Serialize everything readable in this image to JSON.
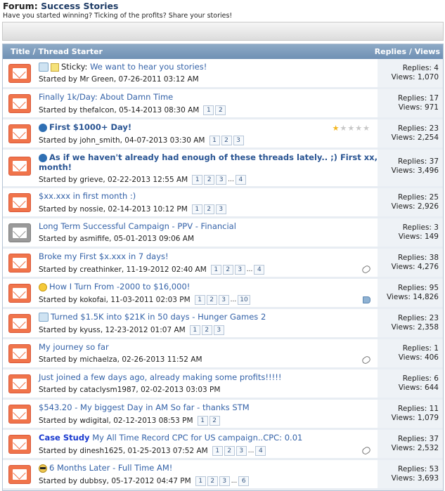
{
  "forum": {
    "prefix": "Forum:",
    "name": "Success Stories",
    "description": "Have you started winning? Ticking of the profits? Share your stories!"
  },
  "table": {
    "header_left": "Title / Thread Starter",
    "header_right": "Replies / Views"
  },
  "threads": [
    {
      "prefix": "Sticky:",
      "title": "We want to hear you stories!",
      "meta": "Started by Mr Green, 07-26-2011 03:12 AM",
      "pages": [],
      "replies": "Replies: 4",
      "views": "Views: 1,070"
    },
    {
      "title": "Finally 1k/Day: About Damn Time",
      "meta": "Started by thefalcon, 05-14-2013 08:30 AM",
      "pages": [
        "1",
        "2"
      ],
      "replies": "Replies: 17",
      "views": "Views: 971"
    },
    {
      "title": "First $1000+ Day!",
      "meta": "Started by john_smith, 04-07-2013 03:30 AM",
      "pages": [
        "1",
        "2",
        "3"
      ],
      "replies": "Replies: 23",
      "views": "Views: 2,254",
      "rating": 1
    },
    {
      "title": "As if we haven't already had enough of these threads lately.. ;) First xx,xxx",
      "title2": "month!",
      "meta": "Started by grieve, 02-22-2013 12:55 AM",
      "pages": [
        "1",
        "2",
        "3",
        "...",
        "4"
      ],
      "replies": "Replies: 37",
      "views": "Views: 3,496"
    },
    {
      "title": "$xx.xxx in first month :)",
      "meta": "Started by nossie, 02-14-2013 10:12 PM",
      "pages": [
        "1",
        "2",
        "3"
      ],
      "replies": "Replies: 25",
      "views": "Views: 2,926"
    },
    {
      "title": "Long Term Successful Campaign - PPV - Financial",
      "meta": "Started by asmifife, 05-01-2013 09:06 AM",
      "pages": [],
      "replies": "Replies: 3",
      "views": "Views: 149"
    },
    {
      "title": "Broke my First $x.xxx in 7 days!",
      "meta": "Started by creathinker, 11-19-2012 02:40 AM",
      "pages": [
        "1",
        "2",
        "3",
        "...",
        "4"
      ],
      "replies": "Replies: 38",
      "views": "Views: 4,276"
    },
    {
      "title": "How I Turn From -2000 to $16,000!",
      "meta": "Started by kokofai, 11-03-2011 02:03 PM",
      "pages": [
        "1",
        "2",
        "3",
        "...",
        "10"
      ],
      "replies": "Replies: 95",
      "views": "Views: 14,826"
    },
    {
      "title": "Turned $1.5K into $21K in 50 days - Hunger Games 2",
      "meta": "Started by kyuss, 12-23-2012 01:07 AM",
      "pages": [
        "1",
        "2",
        "3"
      ],
      "replies": "Replies: 23",
      "views": "Views: 2,358"
    },
    {
      "title": "My journey so far",
      "meta": "Started by michaelza, 02-26-2013 11:52 AM",
      "pages": [],
      "replies": "Replies: 1",
      "views": "Views: 406"
    },
    {
      "title": "Just joined a few days ago, already making some profits!!!!!",
      "meta": "Started by cataclysm1987, 02-02-2013 03:03 PM",
      "pages": [],
      "replies": "Replies: 6",
      "views": "Views: 644"
    },
    {
      "title": "$543.20 - My biggest Day in AM So far - thanks STM",
      "meta": "Started by wdigital, 02-12-2013 08:53 PM",
      "pages": [
        "1",
        "2"
      ],
      "replies": "Replies: 11",
      "views": "Views: 1,079"
    },
    {
      "prefix": "Case Study",
      "title": "My All Time Record CPC for US campaign..CPC: 0.01",
      "meta": "Started by dinesh1625, 01-25-2013 07:52 AM",
      "pages": [
        "1",
        "2",
        "3",
        "...",
        "4"
      ],
      "replies": "Replies: 37",
      "views": "Views: 2,532"
    },
    {
      "title": "6 Months Later - Full Time AM!",
      "meta": "Started by dubbsy, 05-17-2012 04:47 PM",
      "pages": [
        "1",
        "2",
        "3",
        "...",
        "6"
      ],
      "replies": "Replies: 53",
      "views": "Views: 3,693"
    }
  ],
  "colors": {
    "header_bg": "#7c9bbd",
    "link": "#3462a8",
    "thread_icon": "#f0744b",
    "stats_bg": "#eef2f6"
  }
}
